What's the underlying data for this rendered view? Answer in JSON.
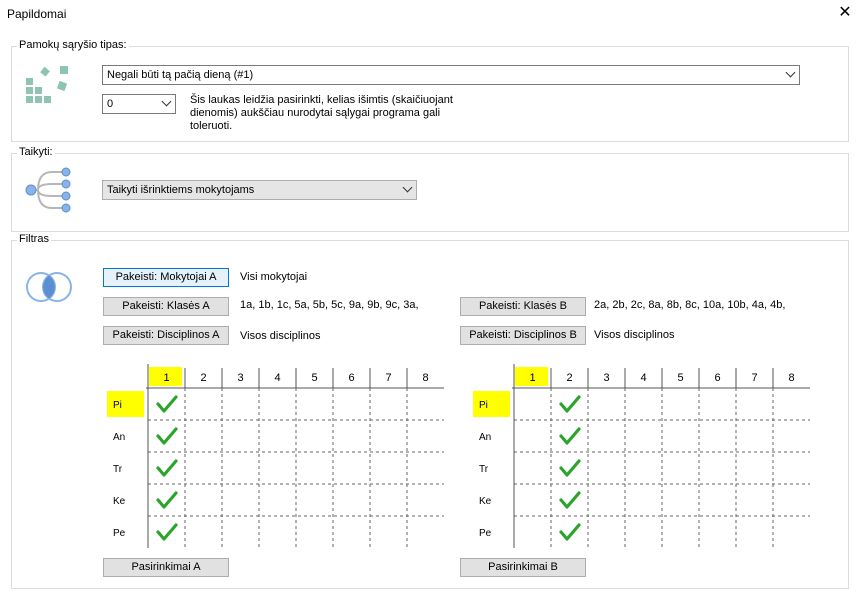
{
  "window": {
    "title": "Papildomai"
  },
  "relation": {
    "legend": "Pamokų sąryšio tipas:",
    "type_value": "Negali būti tą pačią dieną (#1)",
    "exceptions_value": "0",
    "description": "Šis laukas leidžia pasirinkti, kelias išimtis (skaičiuojant dienomis) aukščiau nurodytai sąlygai programa gali toleruoti."
  },
  "apply": {
    "legend": "Taikyti:",
    "value": "Taikyti išrinktiems mokytojams"
  },
  "filter": {
    "legend": "Filtras",
    "teachers_a_btn": "Pakeisti: Mokytojai A",
    "teachers_a_val": "Visi mokytojai",
    "classes_a_btn": "Pakeisti: Klasės A",
    "classes_a_val": "1a, 1b, 1c, 5a, 5b, 5c, 9a, 9b, 9c, 3a,",
    "classes_b_btn": "Pakeisti: Klasės B",
    "classes_b_val": "2a, 2b, 2c, 8a, 8b, 8c, 10a, 10b, 4a, 4b,",
    "subjects_a_btn": "Pakeisti: Disciplinos A",
    "subjects_a_val": "Visos disciplinos",
    "subjects_b_btn": "Pakeisti: Disciplinos B",
    "subjects_b_val": "Visos disciplinos",
    "selections_a_btn": "Pasirinkimai A",
    "selections_b_btn": "Pasirinkimai B"
  },
  "grid_a": {
    "periods": [
      "1",
      "2",
      "3",
      "4",
      "5",
      "6",
      "7",
      "8"
    ],
    "days": [
      "Pi",
      "An",
      "Tr",
      "Ke",
      "Pe"
    ],
    "highlight_period": 0,
    "highlight_day": 0,
    "checked_period": 0
  },
  "grid_b": {
    "periods": [
      "1",
      "2",
      "3",
      "4",
      "5",
      "6",
      "7",
      "8"
    ],
    "days": [
      "Pi",
      "An",
      "Tr",
      "Ke",
      "Pe"
    ],
    "highlight_period": 0,
    "highlight_day": 0,
    "checked_period": 1
  },
  "colors": {
    "highlight": "#ffff00",
    "check": "#2aa52a",
    "focus": "#0078d7"
  }
}
